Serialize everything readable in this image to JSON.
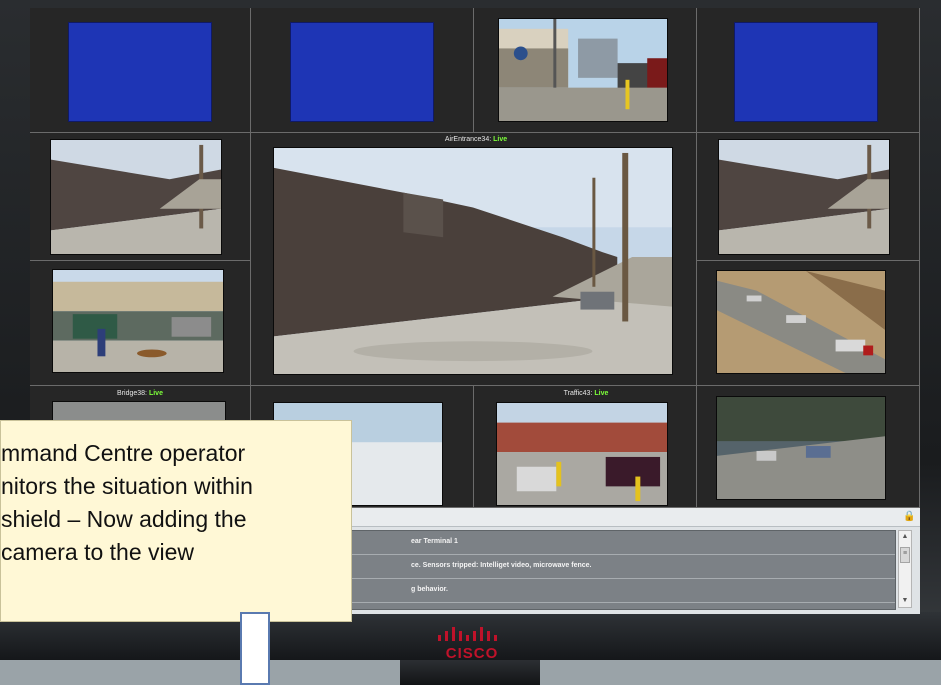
{
  "cameras": {
    "main_label": "AirEntrance34:",
    "bridge_label": "Bridge38:",
    "traffic_label": "Traffic43:",
    "status_live": "Live"
  },
  "events": {
    "rows": [
      "ear Terminal 1",
      "ce. Sensors tripped: Intelliget video, microwave fence.",
      "g behavior."
    ]
  },
  "brand": {
    "name": "CISCO",
    "color": "#c0122a"
  },
  "callout": {
    "lines": [
      "mmand Centre operator",
      "nitors the situation within",
      "shield – Now adding the",
      "camera  to the view"
    ]
  },
  "colors": {
    "live": "#7dff3a",
    "feed_blank": "#1e35b5"
  }
}
